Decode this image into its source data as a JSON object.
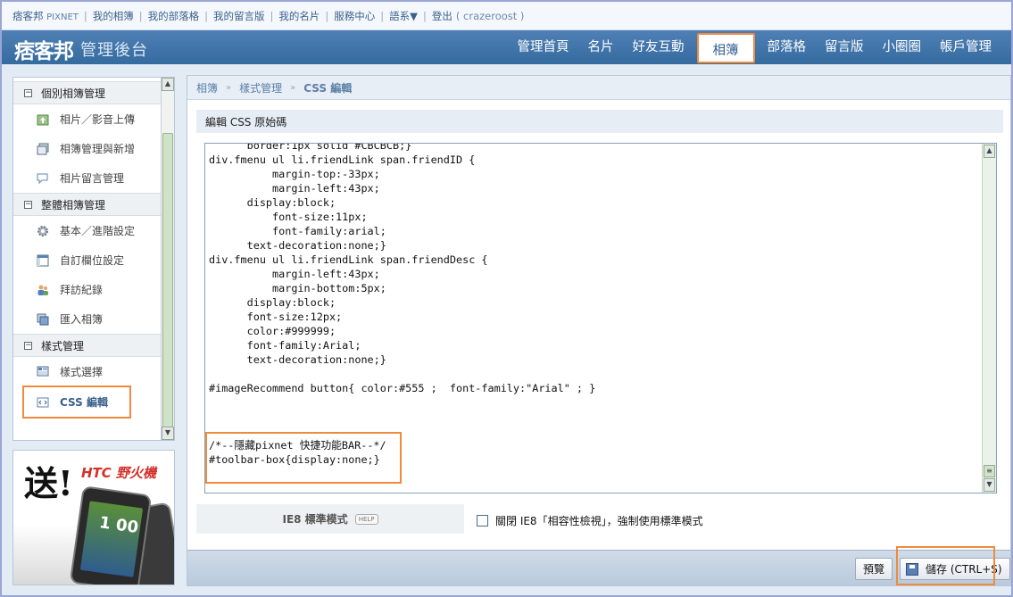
{
  "topbar": {
    "brand": "痞客邦",
    "brand_suffix": "PIXNET",
    "links": [
      "我的相簿",
      "我的部落格",
      "我的留言版",
      "我的名片",
      "服務中心",
      "語系▼"
    ],
    "logout": "登出",
    "username": "( crazeroost )"
  },
  "header": {
    "logo_text": "痞客邦",
    "title": "管理後台",
    "nav": [
      "管理首頁",
      "名片",
      "好友互動",
      "相簿",
      "部落格",
      "留言版",
      "小圈圈",
      "帳戶管理"
    ],
    "active_nav": "相簿"
  },
  "sidebar": {
    "sections": [
      {
        "title": "個別相簿管理",
        "items": [
          {
            "label": "相片／影音上傳",
            "icon": "upload-photo-icon"
          },
          {
            "label": "相簿管理與新增",
            "icon": "album-manage-icon"
          },
          {
            "label": "相片留言管理",
            "icon": "comment-icon"
          }
        ]
      },
      {
        "title": "整體相簿管理",
        "items": [
          {
            "label": "基本／進階設定",
            "icon": "gear-icon"
          },
          {
            "label": "自訂欄位設定",
            "icon": "layout-icon"
          },
          {
            "label": "拜訪紀錄",
            "icon": "visitors-icon"
          },
          {
            "label": "匯入相簿",
            "icon": "import-icon"
          }
        ]
      },
      {
        "title": "樣式管理",
        "items": [
          {
            "label": "樣式選擇",
            "icon": "template-icon"
          },
          {
            "label": "CSS 編輯",
            "icon": "css-edit-icon",
            "active": true
          }
        ]
      }
    ]
  },
  "ad": {
    "headline": "送!",
    "brand": "HTC 野火機"
  },
  "breadcrumb": [
    "相簿",
    "樣式管理",
    "CSS 編輯"
  ],
  "editor": {
    "section_title": "編輯 CSS 原始碼",
    "code_lines": [
      "      border:1px solid #CBCBCB;}",
      "div.fmenu ul li.friendLink span.friendID {",
      "          margin-top:-33px;",
      "          margin-left:43px;",
      "      display:block;",
      "          font-size:11px;",
      "          font-family:arial;",
      "      text-decoration:none;}",
      "div.fmenu ul li.friendLink span.friendDesc {",
      "          margin-left:43px;",
      "          margin-bottom:5px;",
      "      display:block;",
      "      font-size:12px;",
      "      color:#999999;",
      "      font-family:Arial;",
      "      text-decoration:none;}",
      "",
      "#imageRecommend button{ color:#555 ;  font-family:\"Arial\" ; }",
      "",
      "",
      "",
      "/*--隱藏pixnet 快捷功能BAR--*/",
      "#toolbar-box{display:none;}"
    ]
  },
  "ie8": {
    "label": "IE8 標準模式",
    "help": "HELP",
    "option_label": "關閉 IE8「相容性檢視」，強制使用標準模式",
    "checked": false
  },
  "footer": {
    "preview_label": "預覽",
    "save_label": "儲存 (CTRL+S)"
  },
  "colors": {
    "header_blue": "#4577ab",
    "highlight_orange": "#f08a3c",
    "link_blue": "#3a5f8c"
  }
}
